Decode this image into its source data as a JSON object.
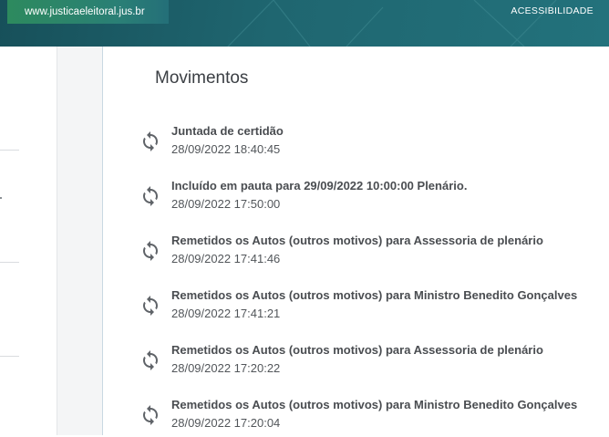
{
  "header": {
    "site_link": "www.justicaeleitoral.jus.br",
    "accessibility_link": "ACESSIBILIDADE"
  },
  "main": {
    "title": "Movimentos",
    "movements": [
      {
        "description": "Juntada de certidão",
        "datetime": "28/09/2022 18:40:45",
        "icon": "refresh-icon"
      },
      {
        "description": "Incluído em pauta para 29/09/2022 10:00:00 Plenário.",
        "datetime": "28/09/2022 17:50:00",
        "icon": "refresh-icon"
      },
      {
        "description": "Remetidos os Autos (outros motivos) para Assessoria de plenário",
        "datetime": "28/09/2022 17:41:46",
        "icon": "refresh-icon"
      },
      {
        "description": "Remetidos os Autos (outros motivos) para Ministro Benedito Gonçalves",
        "datetime": "28/09/2022 17:41:21",
        "icon": "refresh-icon"
      },
      {
        "description": "Remetidos os Autos (outros motivos) para Assessoria de plenário",
        "datetime": "28/09/2022 17:20:22",
        "icon": "refresh-icon"
      },
      {
        "description": "Remetidos os Autos (outros motivos) para Ministro Benedito Gonçalves",
        "datetime": "28/09/2022 17:20:04",
        "icon": "refresh-icon"
      }
    ]
  },
  "colors": {
    "header_background": "#1f6670",
    "site_link_background": "#2d8a5e",
    "text_primary": "#4a4d51",
    "icon": "#5f6368"
  }
}
